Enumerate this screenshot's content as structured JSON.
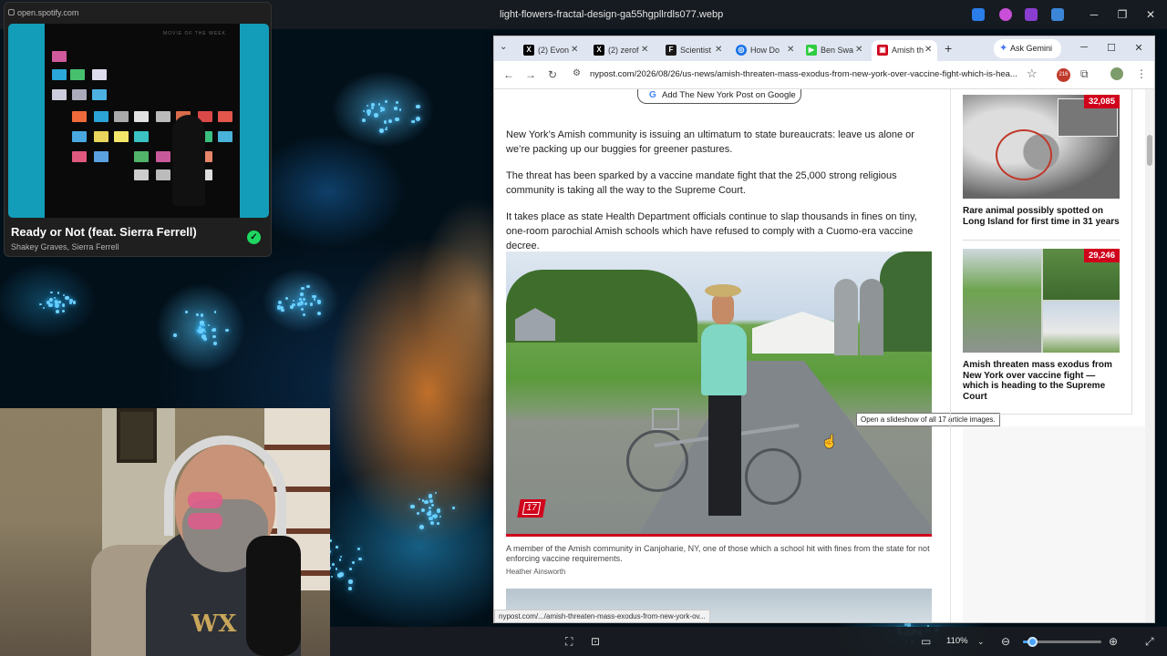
{
  "viewer": {
    "title": "light-flowers-fractal-design-ga55hgpllrdls077.webp",
    "zoom": "110%",
    "zoom_fraction": 0.12,
    "minimize": "─",
    "maximize": "❐",
    "close": "✕"
  },
  "spotify": {
    "url": "open.spotify.com",
    "album_caption": "MOVIE OF THE WEEK",
    "song_title": "Ready or Not (feat. Sierra Ferrell)",
    "artist": "Shakey Graves, Sierra Ferrell",
    "saved_icon": "✓"
  },
  "webcam": {
    "shirt_logo": "WX"
  },
  "browser": {
    "tabs": [
      {
        "label": "(2) Evon",
        "favicon": "X",
        "color": "#000000"
      },
      {
        "label": "(2) zerof",
        "favicon": "X",
        "color": "#000000"
      },
      {
        "label": "Scientist",
        "favicon": "F",
        "color": "#1a1a1a"
      },
      {
        "label": "How Do",
        "favicon": "◎",
        "color": "#1a73e8"
      },
      {
        "label": "Ben Swa",
        "favicon": "▶",
        "color": "#2ecc40"
      },
      {
        "label": "Amish th",
        "favicon": "▣",
        "color": "#d0021b"
      }
    ],
    "new_tab": "+",
    "ask_gemini": "Ask Gemini",
    "url": "nypost.com/2026/08/26/us-news/amish-threaten-mass-exodus-from-new-york-over-vaccine-fight-which-is-hea...",
    "extension_badge": "216",
    "status_url": "nypost.com/.../amish-threaten-mass-exodus-from-new-york-ov..."
  },
  "article": {
    "google_button": "Add The New York Post on Google",
    "paragraphs": [
      "New York’s Amish community is issuing an ultimatum to state bureaucrats: leave us alone or we’re packing up our buggies for greener pastures.",
      "The threat has been sparked by a vaccine mandate fight that the 25,000 strong religious community is taking all the way to the Supreme Court.",
      "It takes place as state Health Department officials continue to slap thousands in fines on tiny, one-room parochial Amish schools which have refused to comply with a Cuomo-era vaccine decree."
    ],
    "photo_count": "17",
    "tooltip": "Open a slideshow of all 17 article images.",
    "caption": "A member of the Amish community in Canjoharie, NY, one of those which a school hit with fines from the state for not enforcing vaccine requirements.",
    "credit": "Heather Ainsworth"
  },
  "sidebar": {
    "cards": [
      {
        "badge": "32,085",
        "title": "Rare animal possibly spotted on Long Island for first time in 31 years"
      },
      {
        "badge": "29,246",
        "title": "Amish threaten mass exodus from New York over vaccine fight —which is heading to the Supreme Court"
      }
    ]
  }
}
